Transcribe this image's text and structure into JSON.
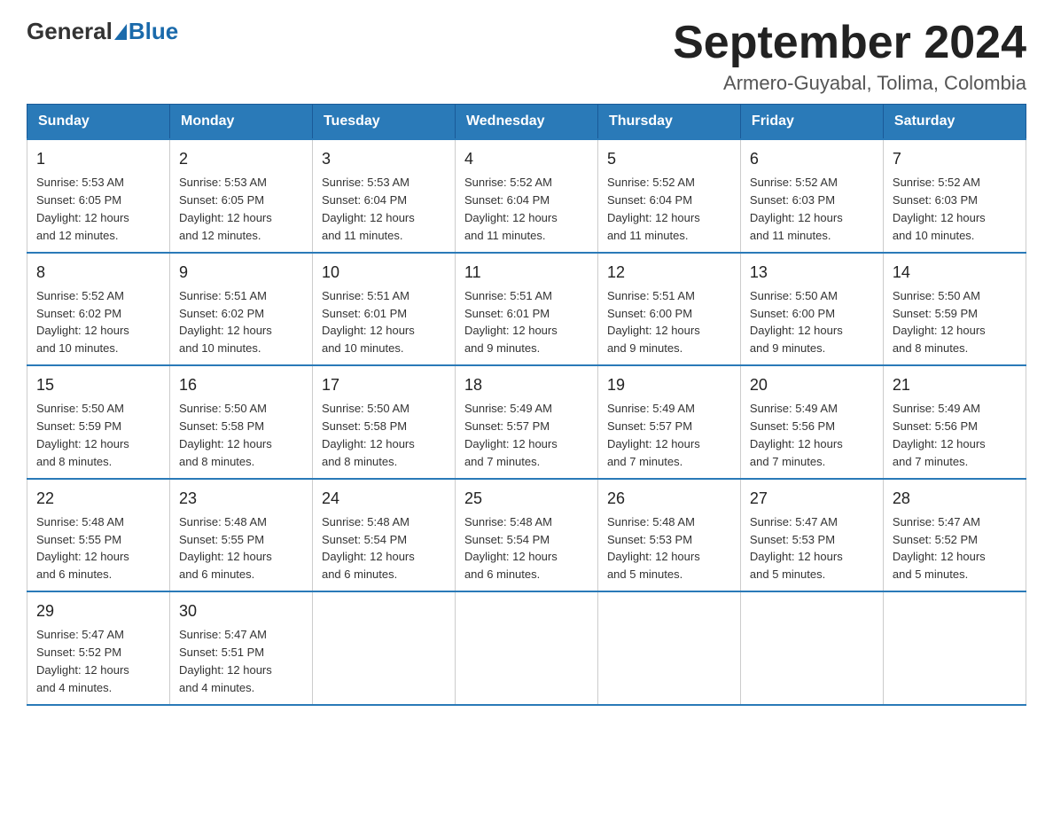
{
  "logo": {
    "general": "General",
    "blue": "Blue"
  },
  "title": {
    "month_year": "September 2024",
    "location": "Armero-Guyabal, Tolima, Colombia"
  },
  "weekdays": [
    "Sunday",
    "Monday",
    "Tuesday",
    "Wednesday",
    "Thursday",
    "Friday",
    "Saturday"
  ],
  "weeks": [
    [
      {
        "day": "1",
        "sunrise": "5:53 AM",
        "sunset": "6:05 PM",
        "daylight": "12 hours and 12 minutes."
      },
      {
        "day": "2",
        "sunrise": "5:53 AM",
        "sunset": "6:05 PM",
        "daylight": "12 hours and 12 minutes."
      },
      {
        "day": "3",
        "sunrise": "5:53 AM",
        "sunset": "6:04 PM",
        "daylight": "12 hours and 11 minutes."
      },
      {
        "day": "4",
        "sunrise": "5:52 AM",
        "sunset": "6:04 PM",
        "daylight": "12 hours and 11 minutes."
      },
      {
        "day": "5",
        "sunrise": "5:52 AM",
        "sunset": "6:04 PM",
        "daylight": "12 hours and 11 minutes."
      },
      {
        "day": "6",
        "sunrise": "5:52 AM",
        "sunset": "6:03 PM",
        "daylight": "12 hours and 11 minutes."
      },
      {
        "day": "7",
        "sunrise": "5:52 AM",
        "sunset": "6:03 PM",
        "daylight": "12 hours and 10 minutes."
      }
    ],
    [
      {
        "day": "8",
        "sunrise": "5:52 AM",
        "sunset": "6:02 PM",
        "daylight": "12 hours and 10 minutes."
      },
      {
        "day": "9",
        "sunrise": "5:51 AM",
        "sunset": "6:02 PM",
        "daylight": "12 hours and 10 minutes."
      },
      {
        "day": "10",
        "sunrise": "5:51 AM",
        "sunset": "6:01 PM",
        "daylight": "12 hours and 10 minutes."
      },
      {
        "day": "11",
        "sunrise": "5:51 AM",
        "sunset": "6:01 PM",
        "daylight": "12 hours and 9 minutes."
      },
      {
        "day": "12",
        "sunrise": "5:51 AM",
        "sunset": "6:00 PM",
        "daylight": "12 hours and 9 minutes."
      },
      {
        "day": "13",
        "sunrise": "5:50 AM",
        "sunset": "6:00 PM",
        "daylight": "12 hours and 9 minutes."
      },
      {
        "day": "14",
        "sunrise": "5:50 AM",
        "sunset": "5:59 PM",
        "daylight": "12 hours and 8 minutes."
      }
    ],
    [
      {
        "day": "15",
        "sunrise": "5:50 AM",
        "sunset": "5:59 PM",
        "daylight": "12 hours and 8 minutes."
      },
      {
        "day": "16",
        "sunrise": "5:50 AM",
        "sunset": "5:58 PM",
        "daylight": "12 hours and 8 minutes."
      },
      {
        "day": "17",
        "sunrise": "5:50 AM",
        "sunset": "5:58 PM",
        "daylight": "12 hours and 8 minutes."
      },
      {
        "day": "18",
        "sunrise": "5:49 AM",
        "sunset": "5:57 PM",
        "daylight": "12 hours and 7 minutes."
      },
      {
        "day": "19",
        "sunrise": "5:49 AM",
        "sunset": "5:57 PM",
        "daylight": "12 hours and 7 minutes."
      },
      {
        "day": "20",
        "sunrise": "5:49 AM",
        "sunset": "5:56 PM",
        "daylight": "12 hours and 7 minutes."
      },
      {
        "day": "21",
        "sunrise": "5:49 AM",
        "sunset": "5:56 PM",
        "daylight": "12 hours and 7 minutes."
      }
    ],
    [
      {
        "day": "22",
        "sunrise": "5:48 AM",
        "sunset": "5:55 PM",
        "daylight": "12 hours and 6 minutes."
      },
      {
        "day": "23",
        "sunrise": "5:48 AM",
        "sunset": "5:55 PM",
        "daylight": "12 hours and 6 minutes."
      },
      {
        "day": "24",
        "sunrise": "5:48 AM",
        "sunset": "5:54 PM",
        "daylight": "12 hours and 6 minutes."
      },
      {
        "day": "25",
        "sunrise": "5:48 AM",
        "sunset": "5:54 PM",
        "daylight": "12 hours and 6 minutes."
      },
      {
        "day": "26",
        "sunrise": "5:48 AM",
        "sunset": "5:53 PM",
        "daylight": "12 hours and 5 minutes."
      },
      {
        "day": "27",
        "sunrise": "5:47 AM",
        "sunset": "5:53 PM",
        "daylight": "12 hours and 5 minutes."
      },
      {
        "day": "28",
        "sunrise": "5:47 AM",
        "sunset": "5:52 PM",
        "daylight": "12 hours and 5 minutes."
      }
    ],
    [
      {
        "day": "29",
        "sunrise": "5:47 AM",
        "sunset": "5:52 PM",
        "daylight": "12 hours and 4 minutes."
      },
      {
        "day": "30",
        "sunrise": "5:47 AM",
        "sunset": "5:51 PM",
        "daylight": "12 hours and 4 minutes."
      },
      null,
      null,
      null,
      null,
      null
    ]
  ],
  "labels": {
    "sunrise": "Sunrise:",
    "sunset": "Sunset:",
    "daylight": "Daylight:"
  }
}
